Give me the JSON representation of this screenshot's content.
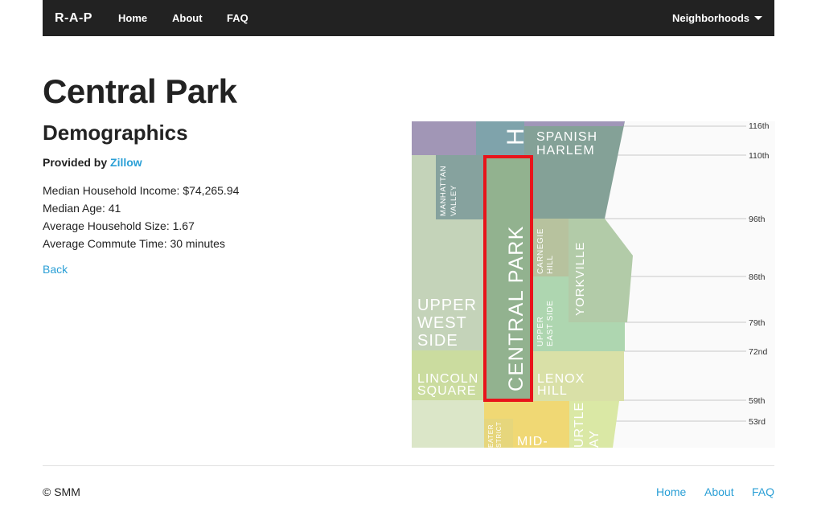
{
  "navbar": {
    "brand": "R-A-P",
    "links": [
      "Home",
      "About",
      "FAQ"
    ],
    "dropdown_label": "Neighborhoods"
  },
  "page": {
    "title": "Central Park",
    "section": "Demographics",
    "provided_by_prefix": "Provided by",
    "provider": "Zillow",
    "stats": [
      "Median Household Income: $74,265.94",
      "Median Age: 41",
      "Average Household Size: 1.67",
      "Average Commute Time: 30 minutes"
    ],
    "back_label": "Back"
  },
  "map": {
    "highlight_color": "#e8141b",
    "neighborhoods": {
      "spanish_harlem": [
        "SPANISH",
        "HARLEM"
      ],
      "manhattan_valley": [
        "MANHATTAN",
        "VALLEY"
      ],
      "central_park": "CENTRAL PARK",
      "carnegie_hill": [
        "CARNEGIE",
        "HILL"
      ],
      "yorkville": "YORKVILLE",
      "upper_east_side": [
        "UPPER",
        "EAST SIDE"
      ],
      "upper_west_side": [
        "UPPER",
        "WEST",
        "SIDE"
      ],
      "lincoln_square": [
        "LINCOLN",
        "SQUARE"
      ],
      "lenox_hill": [
        "LENOX",
        "HILL"
      ],
      "theater_district": [
        "EATER",
        "STRICT"
      ],
      "midtown": "MID-",
      "turtle_bay": [
        "URTLE",
        "AY"
      ],
      "harlem_fragment": "H"
    },
    "streets": [
      "116th",
      "110th",
      "96th",
      "86th",
      "79th",
      "72nd",
      "59th",
      "53rd"
    ]
  },
  "footer": {
    "copyright": "© SMM",
    "links": [
      "Home",
      "About",
      "FAQ"
    ]
  }
}
